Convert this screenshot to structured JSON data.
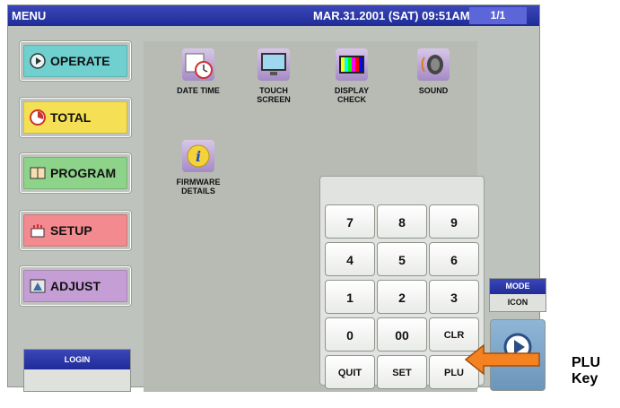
{
  "titlebar": {
    "menu": "MENU",
    "datetime": "MAR.31.2001 (SAT) 09:51AM",
    "page": "1/1"
  },
  "sidebar": [
    {
      "label": "OPERATE",
      "color": "#6fd0cf"
    },
    {
      "label": "TOTAL",
      "color": "#f4df55"
    },
    {
      "label": "PROGRAM",
      "color": "#8ed38a"
    },
    {
      "label": "SETUP",
      "color": "#f28a8f"
    },
    {
      "label": "ADJUST",
      "color": "#c59ed6"
    }
  ],
  "icons": [
    {
      "label": "DATE TIME",
      "icon": "calendar-clock-icon"
    },
    {
      "label_l1": "TOUCH",
      "label_l2": "SCREEN",
      "icon": "monitor-icon"
    },
    {
      "label_l1": "DISPLAY",
      "label_l2": "CHECK",
      "icon": "color-bars-icon"
    },
    {
      "label": "SOUND",
      "icon": "speaker-icon"
    },
    {
      "label_l1": "FIRMWARE",
      "label_l2": "DETAILS",
      "icon": "info-icon"
    }
  ],
  "keypad": {
    "keys": [
      "7",
      "8",
      "9",
      "4",
      "5",
      "6",
      "1",
      "2",
      "3",
      "0",
      "00",
      "CLR",
      "QUIT",
      "SET",
      "PLU"
    ]
  },
  "login": {
    "label": "LOGIN"
  },
  "mode": {
    "title": "MODE",
    "value": "ICON"
  },
  "callout": {
    "text": "PLU Key",
    "color": "#f58220"
  }
}
